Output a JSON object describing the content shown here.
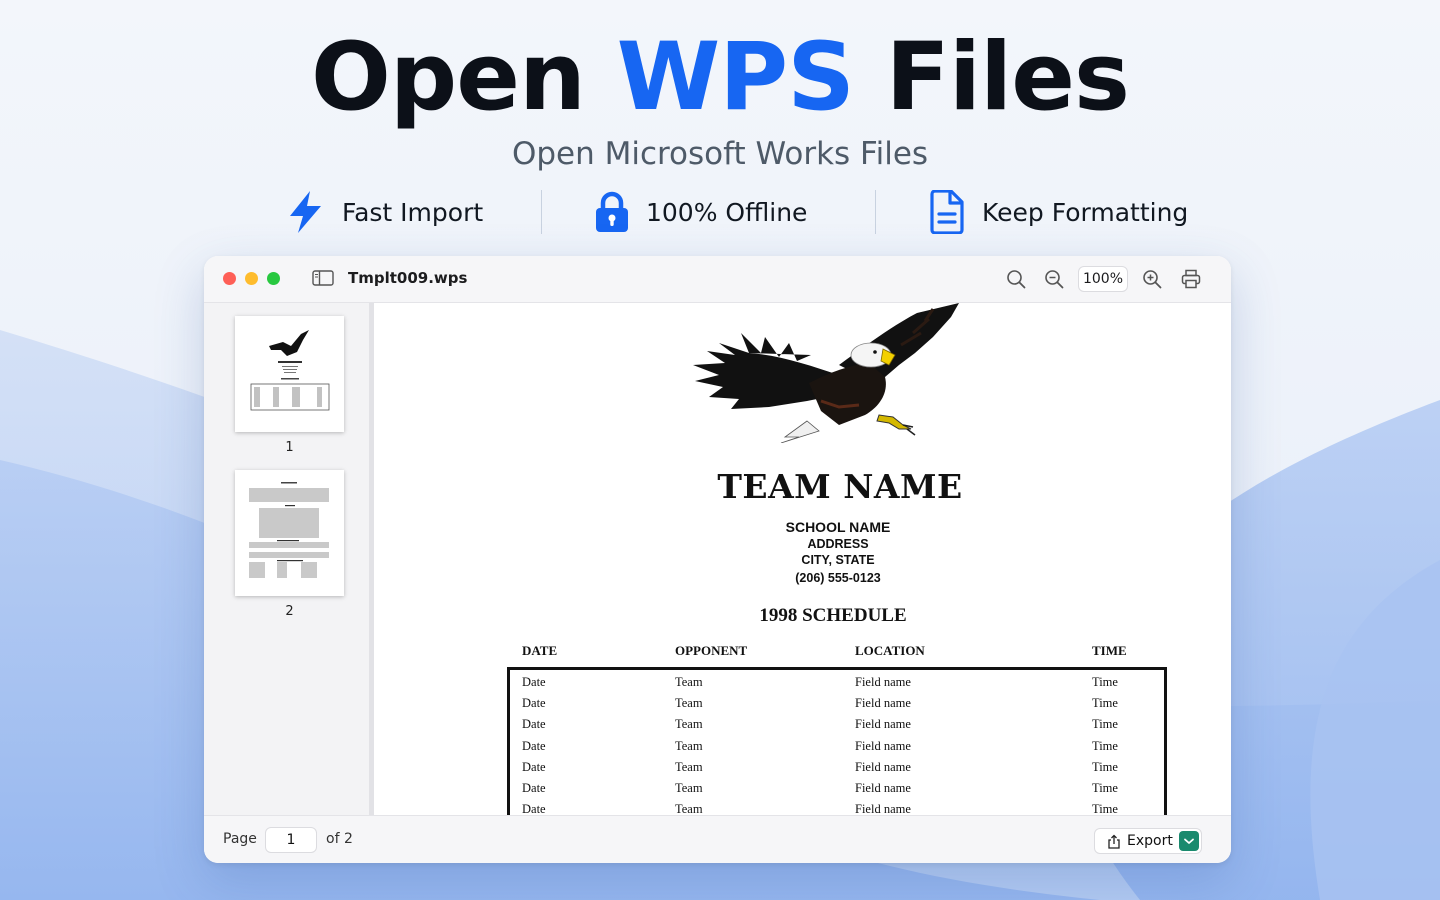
{
  "hero": {
    "title_pre": "Open",
    "title_accent": "WPS",
    "title_post": "Files",
    "subtitle": "Open Microsoft Works Files",
    "features": [
      {
        "icon": "lightning-icon",
        "label": "Fast Import"
      },
      {
        "icon": "lock-icon",
        "label": "100% Offline"
      },
      {
        "icon": "document-icon",
        "label": "Keep Formatting"
      }
    ],
    "accent_color": "#1766f2"
  },
  "window": {
    "filename": "Tmplt009.wps",
    "zoom": "100%",
    "toolbar_icons": [
      "search-icon",
      "zoom-out-icon",
      "zoom-in-icon",
      "print-icon"
    ]
  },
  "sidebar": {
    "thumbnails": [
      {
        "page": "1"
      },
      {
        "page": "2"
      }
    ]
  },
  "document": {
    "team_name": "TEAM NAME",
    "school_name": "SCHOOL NAME",
    "address": "ADDRESS",
    "city_state": "CITY, STATE",
    "phone": "(206) 555-0123",
    "schedule_title": "1998 SCHEDULE",
    "columns": [
      "DATE",
      "OPPONENT",
      "LOCATION",
      "TIME"
    ],
    "rows": [
      [
        "Date",
        "Team",
        "Field name",
        "Time"
      ],
      [
        "Date",
        "Team",
        "Field name",
        "Time"
      ],
      [
        "Date",
        "Team",
        "Field name",
        "Time"
      ],
      [
        "Date",
        "Team",
        "Field name",
        "Time"
      ],
      [
        "Date",
        "Team",
        "Field name",
        "Time"
      ],
      [
        "Date",
        "Team",
        "Field name",
        "Time"
      ],
      [
        "Date",
        "Team",
        "Field name",
        "Time"
      ]
    ]
  },
  "footer": {
    "page_label": "Page",
    "page_value": "1",
    "page_total": "of 2",
    "export_label": "Export"
  }
}
